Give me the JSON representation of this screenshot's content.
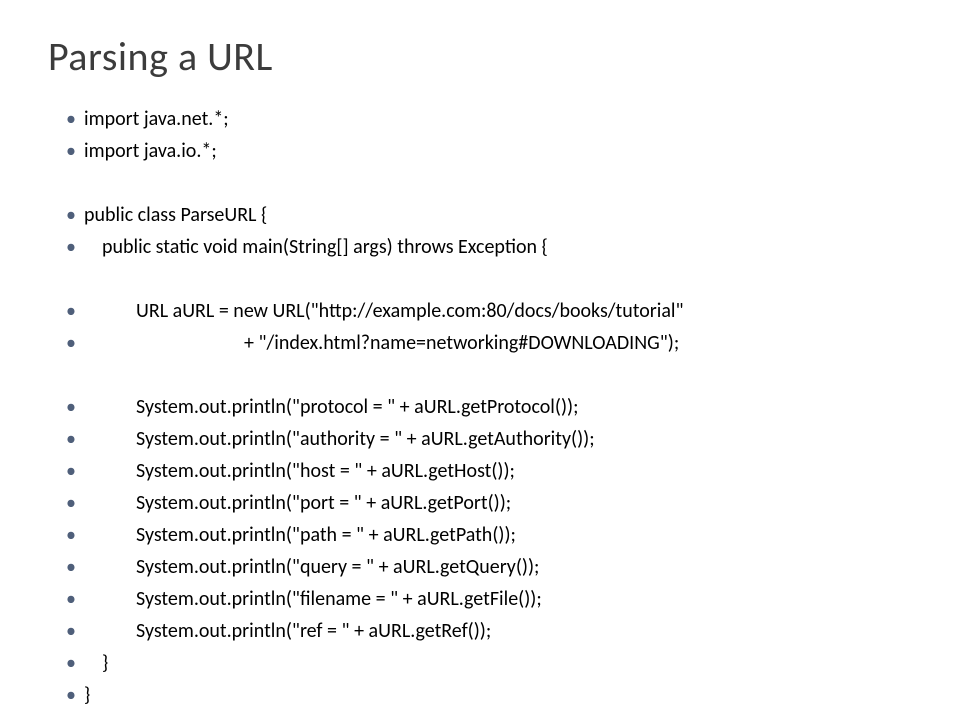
{
  "title": "Parsing a URL",
  "lines": [
    {
      "text": "import java.net.*;",
      "cls": ""
    },
    {
      "text": "import java.io.*;",
      "cls": ""
    },
    {
      "text": "",
      "cls": "blank"
    },
    {
      "text": "public class ParseURL {",
      "cls": ""
    },
    {
      "text": "public static void main(String[] args) throws Exception {",
      "cls": "ind1"
    },
    {
      "text": "",
      "cls": "blank"
    },
    {
      "text": "URL aURL = new URL(\"http://example.com:80/docs/books/tutorial\"",
      "cls": "ind2"
    },
    {
      "text": "+ \"/index.html?name=networking#DOWNLOADING\");",
      "cls": "ind3"
    },
    {
      "text": "",
      "cls": "blank"
    },
    {
      "text": "System.out.println(\"protocol = \" + aURL.getProtocol());",
      "cls": "ind2"
    },
    {
      "text": "System.out.println(\"authority = \" + aURL.getAuthority());",
      "cls": "ind2"
    },
    {
      "text": "System.out.println(\"host = \" + aURL.getHost());",
      "cls": "ind2"
    },
    {
      "text": "System.out.println(\"port = \" + aURL.getPort());",
      "cls": "ind2"
    },
    {
      "text": "System.out.println(\"path = \" + aURL.getPath());",
      "cls": "ind2"
    },
    {
      "text": "System.out.println(\"query = \" + aURL.getQuery());",
      "cls": "ind2"
    },
    {
      "text": "System.out.println(\"filename = \" + aURL.getFile());",
      "cls": "ind2"
    },
    {
      "text": "System.out.println(\"ref = \" + aURL.getRef());",
      "cls": "ind2"
    },
    {
      "text": "}",
      "cls": "ind1"
    },
    {
      "text": "}",
      "cls": ""
    }
  ]
}
